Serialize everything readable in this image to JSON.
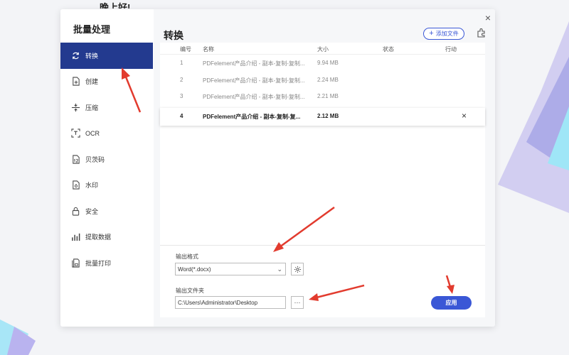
{
  "background_text": "晚上好!",
  "sidebar": {
    "title": "批量处理",
    "items": [
      {
        "label": "转换",
        "icon": "convert-icon",
        "active": true
      },
      {
        "label": "创建",
        "icon": "create-icon"
      },
      {
        "label": "压缩",
        "icon": "compress-icon"
      },
      {
        "label": "OCR",
        "icon": "ocr-icon"
      },
      {
        "label": "贝茨码",
        "icon": "bates-icon"
      },
      {
        "label": "水印",
        "icon": "watermark-icon"
      },
      {
        "label": "安全",
        "icon": "lock-icon"
      },
      {
        "label": "提取数据",
        "icon": "extract-data-icon"
      },
      {
        "label": "批量打印",
        "icon": "print-icon"
      }
    ]
  },
  "main": {
    "title": "转换",
    "add_files_label": "添加文件",
    "close_glyph": "×",
    "table": {
      "columns": {
        "index": "编号",
        "name": "名称",
        "size": "大小",
        "status": "状态",
        "action": "行动"
      },
      "rows": [
        {
          "index": "1",
          "name": "PDFelement产品介绍 - 副本-复制-复制...",
          "size": "9.94 MB",
          "selected": false
        },
        {
          "index": "2",
          "name": "PDFelement产品介绍 - 副本-复制-复制...",
          "size": "2.24 MB",
          "selected": false
        },
        {
          "index": "3",
          "name": "PDFelement产品介绍 - 副本-复制-复制...",
          "size": "2.21 MB",
          "selected": false
        },
        {
          "index": "4",
          "name": "PDFelement产品介绍 - 副本-复制-复...",
          "size": "2.12 MB",
          "selected": true
        }
      ]
    },
    "output_format_label": "输出格式",
    "output_format_value": "Word(*.docx)",
    "output_folder_label": "输出文件夹",
    "output_folder_value": "C:\\Users\\Administrator\\Desktop",
    "browse_label": "···",
    "apply_label": "应用"
  },
  "colors": {
    "accent": "#3a57d6",
    "active_nav": "#233a8f",
    "annotation_arrow": "#e23b2e"
  }
}
